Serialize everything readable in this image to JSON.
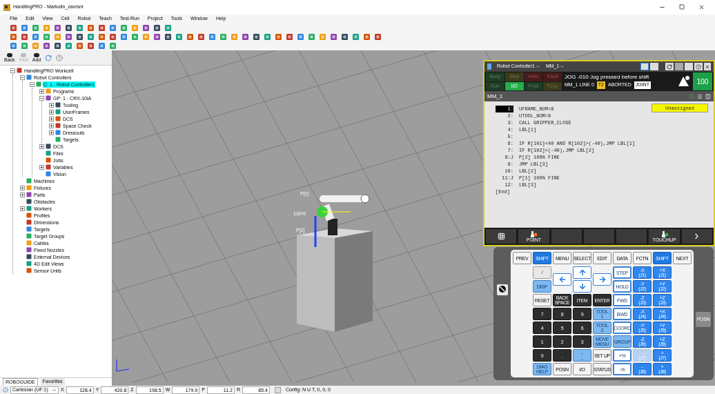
{
  "window": {
    "title": "HandlingPRO - Markulin_zavrsni"
  },
  "menu": [
    "File",
    "Edit",
    "View",
    "Cell",
    "Robot",
    "Teach",
    "Test-Run",
    "Project",
    "Tools",
    "Window",
    "Help"
  ],
  "nav_buttons": [
    {
      "label": "Back",
      "disabled": false
    },
    {
      "label": "Fwd",
      "disabled": true
    },
    {
      "label": "Add",
      "disabled": false
    }
  ],
  "tree": [
    {
      "label": "HandlingPRO Workcell",
      "expanded": true,
      "selected": false,
      "children": [
        {
          "label": "Robot Controllers",
          "expanded": true,
          "selected": false,
          "children": [
            {
              "label": "C: 1 - Robot Controller1",
              "expanded": true,
              "selected": true,
              "children": [
                {
                  "label": "Programs",
                  "expanded": false,
                  "selected": false
                },
                {
                  "label": "GP: 1 - CRX-10iA",
                  "expanded": true,
                  "selected": false,
                  "children": [
                    {
                      "label": "Tooling",
                      "expanded": false,
                      "selected": false
                    },
                    {
                      "label": "UserFrames",
                      "expanded": false,
                      "selected": false
                    },
                    {
                      "label": "DCS",
                      "expanded": false,
                      "selected": false
                    },
                    {
                      "label": "Space Check",
                      "expanded": false,
                      "selected": false
                    },
                    {
                      "label": "Dressouts",
                      "expanded": false,
                      "selected": false
                    },
                    {
                      "label": "Targets",
                      "selected": false
                    }
                  ]
                },
                {
                  "label": "DCS",
                  "expanded": false,
                  "selected": false
                },
                {
                  "label": "Files",
                  "selected": false
                },
                {
                  "label": "Jobs",
                  "selected": false
                },
                {
                  "label": "Variables",
                  "expanded": false,
                  "selected": false
                },
                {
                  "label": "Vision",
                  "selected": false
                }
              ]
            }
          ]
        },
        {
          "label": "Machines",
          "selected": false
        },
        {
          "label": "Fixtures",
          "expanded": false,
          "selected": false
        },
        {
          "label": "Parts",
          "expanded": false,
          "selected": false
        },
        {
          "label": "Obstacles",
          "selected": false
        },
        {
          "label": "Workers",
          "expanded": false,
          "selected": false
        },
        {
          "label": "Profiles",
          "selected": false
        },
        {
          "label": "Dimensions",
          "selected": false
        },
        {
          "label": "Targets",
          "selected": false
        },
        {
          "label": "Target Groups",
          "selected": false
        },
        {
          "label": "Cables",
          "selected": false
        },
        {
          "label": "Fixed Nozzles",
          "selected": false
        },
        {
          "label": "External Devices",
          "selected": false
        },
        {
          "label": "4D Edit Views",
          "selected": false
        },
        {
          "label": "Sensor Units",
          "selected": false
        }
      ]
    }
  ],
  "panel_tabs": [
    {
      "label": "ROBOGUIDE",
      "selected": true
    },
    {
      "label": "Favorites",
      "selected": false
    }
  ],
  "scene_labels": [
    "P[1]",
    "100%",
    "P[2]"
  ],
  "pendant": {
    "controller": "Robot Controller1",
    "program_menu": "MM_1",
    "lamps": [
      {
        "label": "Busy",
        "kind": "ok",
        "on": false
      },
      {
        "label": "Step",
        "kind": "warn",
        "on": false
      },
      {
        "label": "Hold",
        "kind": "alarm",
        "on": false
      },
      {
        "label": "Fault",
        "kind": "alarm",
        "on": false
      },
      {
        "label": "Run",
        "kind": "ok",
        "on": false
      },
      {
        "label": "I/O",
        "kind": "ok",
        "on": true
      },
      {
        "label": "Prod",
        "kind": "ok",
        "on": false
      },
      {
        "label": "TCyc",
        "kind": "warn",
        "on": false
      }
    ],
    "message": "JOG -010 Jog pressed before shift",
    "status_line": "MM_1 LINE 0",
    "mode": "T2",
    "state": "ABORTED",
    "coord": "JOINT",
    "override": "100",
    "screen_title": "MM_1",
    "assign_button": "Unassigned",
    "lines": [
      {
        "num": "1:",
        "text": "UFRAME_NUM=8",
        "selected": true
      },
      {
        "num": "2:",
        "text": "UTOOL_NUM=9",
        "selected": false
      },
      {
        "num": "3:",
        "text": "CALL GRIPPER_CLOSE",
        "selected": false
      },
      {
        "num": "4:",
        "text": "LBL[1]",
        "selected": false
      },
      {
        "num": "5:",
        "selected": false
      },
      {
        "num": "6:",
        "text": "IF R[101]<40 AND R[102]>(-40),JMP LBL[1]",
        "selected": false
      },
      {
        "num": "7:",
        "text": "IF R[102]<(-40),JMP LBL[2]",
        "selected": false
      },
      {
        "num": "8:J",
        "text": "P[2] 100% FINE",
        "selected": false
      },
      {
        "num": "9:",
        "text": "JMP LBL[3]",
        "selected": false
      },
      {
        "num": "10:",
        "text": "LBL[2]",
        "selected": false
      },
      {
        "num": "11:J",
        "text": "P[1] 100% FINE",
        "selected": false
      },
      {
        "num": "12:",
        "text": "LBL[3]",
        "selected": false
      }
    ],
    "end_marker": "[End]",
    "softkeys": [
      {
        "kind": "menu"
      },
      {
        "kind": "point",
        "label": "POINT"
      },
      {
        "kind": "empty"
      },
      {
        "kind": "empty"
      },
      {
        "kind": "empty"
      },
      {
        "kind": "touchup",
        "label": "TOUCHUP"
      },
      {
        "kind": "next"
      }
    ]
  },
  "keypad": {
    "top_row": [
      {
        "label": "PREV",
        "kind": "function"
      },
      {
        "label": "SHIFT",
        "kind": "shift"
      },
      {
        "label": "MENU",
        "kind": "function"
      },
      {
        "label": "SELECT",
        "kind": "function"
      },
      {
        "label": "EDIT",
        "kind": "function"
      },
      {
        "label": "DATA",
        "kind": "function"
      },
      {
        "label": "FCTN",
        "kind": "function"
      },
      {
        "label": "SHIFT",
        "kind": "shift"
      },
      {
        "label": "NEXT",
        "kind": "function"
      }
    ],
    "keys": [
      {
        "kind": "info",
        "label": "i"
      },
      {
        "kind": "left-arrow"
      },
      {
        "kind": "up-arrow"
      },
      {
        "kind": "right-arrow"
      },
      {
        "label": "STEP",
        "kind": "motion"
      },
      {
        "label": "-X",
        "sub": "(J1)",
        "kind": "jog"
      },
      {
        "label": "+X",
        "sub": "(J1)",
        "kind": "jog"
      },
      {
        "label": "DISP",
        "kind": "tool"
      },
      {
        "kind": "down-arrow"
      },
      {
        "label": "HOLD",
        "kind": "motion"
      },
      {
        "label": "-Y",
        "sub": "(J2)",
        "kind": "jog"
      },
      {
        "label": "+Y",
        "sub": "(J2)",
        "kind": "jog"
      },
      {
        "label": "RESET",
        "kind": "function"
      },
      {
        "label": "BACK SPACE",
        "kind": "number"
      },
      {
        "label": "ITEM",
        "kind": "number"
      },
      {
        "label": "ENTER",
        "kind": "number"
      },
      {
        "label": "FWD",
        "kind": "motion"
      },
      {
        "label": "-Z",
        "sub": "(J3)",
        "kind": "jog"
      },
      {
        "label": "+Z",
        "sub": "(J3)",
        "kind": "jog"
      },
      {
        "label": "7",
        "kind": "number"
      },
      {
        "label": "8",
        "kind": "number"
      },
      {
        "label": "9",
        "kind": "number"
      },
      {
        "label": "TOOL",
        "sub": "1",
        "kind": "tool"
      },
      {
        "label": "BWD",
        "kind": "motion"
      },
      {
        "label": "-X",
        "sub": "(J4)",
        "kind": "jog"
      },
      {
        "label": "+X",
        "sub": "(J4)",
        "kind": "jog"
      },
      {
        "label": "4",
        "kind": "number"
      },
      {
        "label": "5",
        "kind": "number"
      },
      {
        "label": "6",
        "kind": "number"
      },
      {
        "label": "TOOL",
        "sub": "2",
        "kind": "tool"
      },
      {
        "label": "COORD",
        "kind": "motion"
      },
      {
        "label": "-Y",
        "sub": "(J5)",
        "kind": "jog"
      },
      {
        "label": "+Y",
        "sub": "(J5)",
        "kind": "jog"
      },
      {
        "label": "1",
        "kind": "number"
      },
      {
        "label": "2",
        "kind": "number"
      },
      {
        "label": "3",
        "kind": "number"
      },
      {
        "label": "MOVE MENU",
        "kind": "tool"
      },
      {
        "label": "GROUP",
        "kind": "tool"
      },
      {
        "label": "-Z",
        "sub": "(J6)",
        "kind": "jog"
      },
      {
        "label": "+Z",
        "sub": "(J6)",
        "kind": "jog"
      },
      {
        "label": "0",
        "kind": "number"
      },
      {
        "label": ".",
        "kind": "number"
      },
      {
        "label": "-",
        "sub": ",",
        "kind": "tool"
      },
      {
        "label": "SET UP",
        "kind": "function"
      },
      {
        "label": "+%",
        "kind": "motion"
      },
      {
        "label": "-",
        "sub": "(J7)",
        "kind": "jog",
        "disabled": true
      },
      {
        "label": "+",
        "sub": "(J7)",
        "kind": "jog"
      },
      {
        "label": "DIAG HELP",
        "kind": "tool"
      },
      {
        "label": "POSN",
        "kind": "function"
      },
      {
        "label": "I/O",
        "kind": "function"
      },
      {
        "label": "STATUS",
        "kind": "function"
      },
      {
        "label": "-%",
        "kind": "motion"
      },
      {
        "label": "-",
        "sub": "(J8)",
        "kind": "jog"
      },
      {
        "label": "+",
        "sub": "(J8)",
        "kind": "jog"
      }
    ],
    "side_key": "POSN"
  },
  "status_bar": {
    "frame": "Cartesian (UF:1)",
    "coords": [
      {
        "axis": "X",
        "value": "128.4"
      },
      {
        "axis": "Y",
        "value": "420.8"
      },
      {
        "axis": "Z",
        "value": "198.5"
      },
      {
        "axis": "W",
        "value": "179.9"
      },
      {
        "axis": "P",
        "value": "11.2"
      },
      {
        "axis": "R",
        "value": "85.4"
      }
    ],
    "config": "Config: N U T, 0, 0, 0"
  }
}
